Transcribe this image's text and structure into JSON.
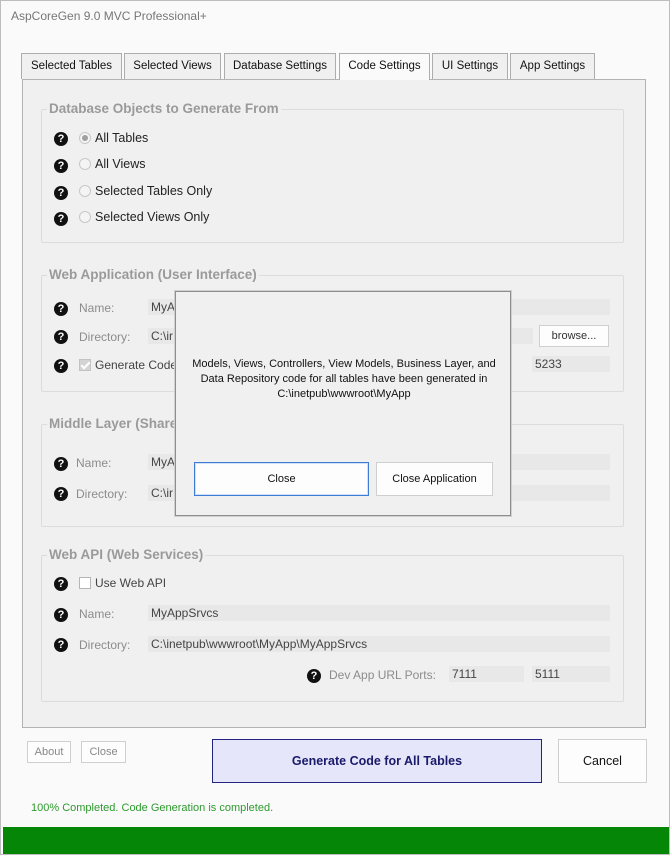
{
  "window": {
    "title": "AspCoreGen 9.0 MVC Professional+"
  },
  "tabs": [
    {
      "label": "Selected Tables",
      "active": false
    },
    {
      "label": "Selected Views",
      "active": false
    },
    {
      "label": "Database Settings",
      "active": false
    },
    {
      "label": "Code Settings",
      "active": true
    },
    {
      "label": "UI Settings",
      "active": false
    },
    {
      "label": "App Settings",
      "active": false
    }
  ],
  "db_objects": {
    "title": "Database Objects to Generate From",
    "options": [
      {
        "label": "All Tables",
        "selected": true
      },
      {
        "label": "All Views",
        "selected": false
      },
      {
        "label": "Selected Tables Only",
        "selected": false
      },
      {
        "label": "Selected Views Only",
        "selected": false
      }
    ]
  },
  "web_app": {
    "title": "Web Application (User Interface)",
    "name_label": "Name:",
    "name_value": "MyA",
    "directory_label": "Directory:",
    "directory_value": "C:\\ir",
    "browse_label": "browse...",
    "generate_code_label": "Generate Code",
    "generate_code_checked": true,
    "port_value": "5233"
  },
  "middle_layer": {
    "title": "Middle Layer (Share",
    "name_label": "Name:",
    "name_value": "MyA",
    "directory_label": "Directory:",
    "directory_value": "C:\\ir"
  },
  "web_api": {
    "title": "Web API (Web Services)",
    "use_label": "Use Web API",
    "use_checked": false,
    "name_label": "Name:",
    "name_value": "MyAppSrvcs",
    "directory_label": "Directory:",
    "directory_value": "C:\\inetpub\\wwwroot\\MyApp\\MyAppSrvcs",
    "ports_label": "Dev App URL Ports:",
    "port1": "7111",
    "port2": "5111"
  },
  "footer": {
    "about_label": "About",
    "close_label": "Close",
    "generate_label": "Generate Code for All Tables",
    "cancel_label": "Cancel",
    "status": "100% Completed.  Code Generation is completed.",
    "progress": 1.0,
    "status_color": "#2e9a2e",
    "progress_color": "#068606"
  },
  "dialog": {
    "message_line1": "Models, Views, Controllers, View Models, Business Layer, and",
    "message_line2": "Data Repository code for all tables have been generated in",
    "message_line3": "C:\\inetpub\\wwwroot\\MyApp",
    "close_label": "Close",
    "close_app_label": "Close Application"
  },
  "icons": {
    "help": "question-circle-icon"
  }
}
